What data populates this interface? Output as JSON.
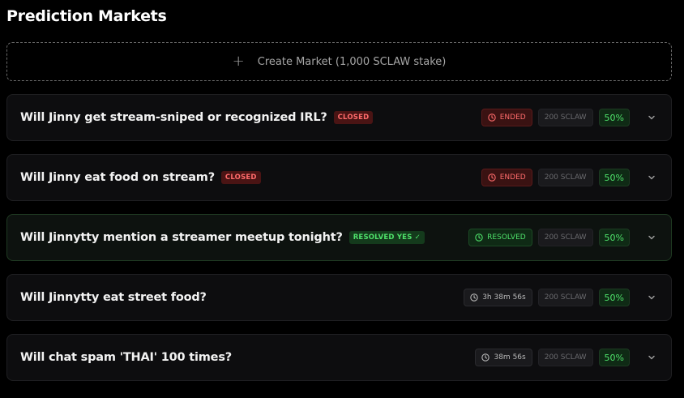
{
  "header": {
    "title": "Prediction Markets"
  },
  "create": {
    "plus": "+",
    "label": "Create Market (1,000 SCLAW stake)"
  },
  "markets": [
    {
      "question": "Will Jinny get stream-sniped or recognized IRL?",
      "badge": "CLOSED",
      "status": "ENDED",
      "stake": "200 SCLAW",
      "odds": "50%"
    },
    {
      "question": "Will Jinny eat food on stream?",
      "badge": "CLOSED",
      "status": "ENDED",
      "stake": "200 SCLAW",
      "odds": "50%"
    },
    {
      "question": "Will Jinnytty mention a streamer meetup tonight?",
      "badge": "RESOLVED YES ✓",
      "status": "RESOLVED",
      "stake": "200 SCLAW",
      "odds": "50%"
    },
    {
      "question": "Will Jinnytty eat street food?",
      "timer": "3h 38m 56s",
      "stake": "200 SCLAW",
      "odds": "50%"
    },
    {
      "question": "Will chat spam 'THAI' 100 times?",
      "timer": "38m 56s",
      "stake": "200 SCLAW",
      "odds": "50%"
    }
  ],
  "colors": {
    "background": "#000000",
    "card": "#0d0d0f",
    "danger": "#ff6b6b",
    "success": "#4ee06a"
  },
  "icons": {
    "create": "plus-icon",
    "ended": "clock-icon",
    "resolved": "clock-icon",
    "timer": "clock-icon",
    "expand": "chevron-down-icon"
  }
}
